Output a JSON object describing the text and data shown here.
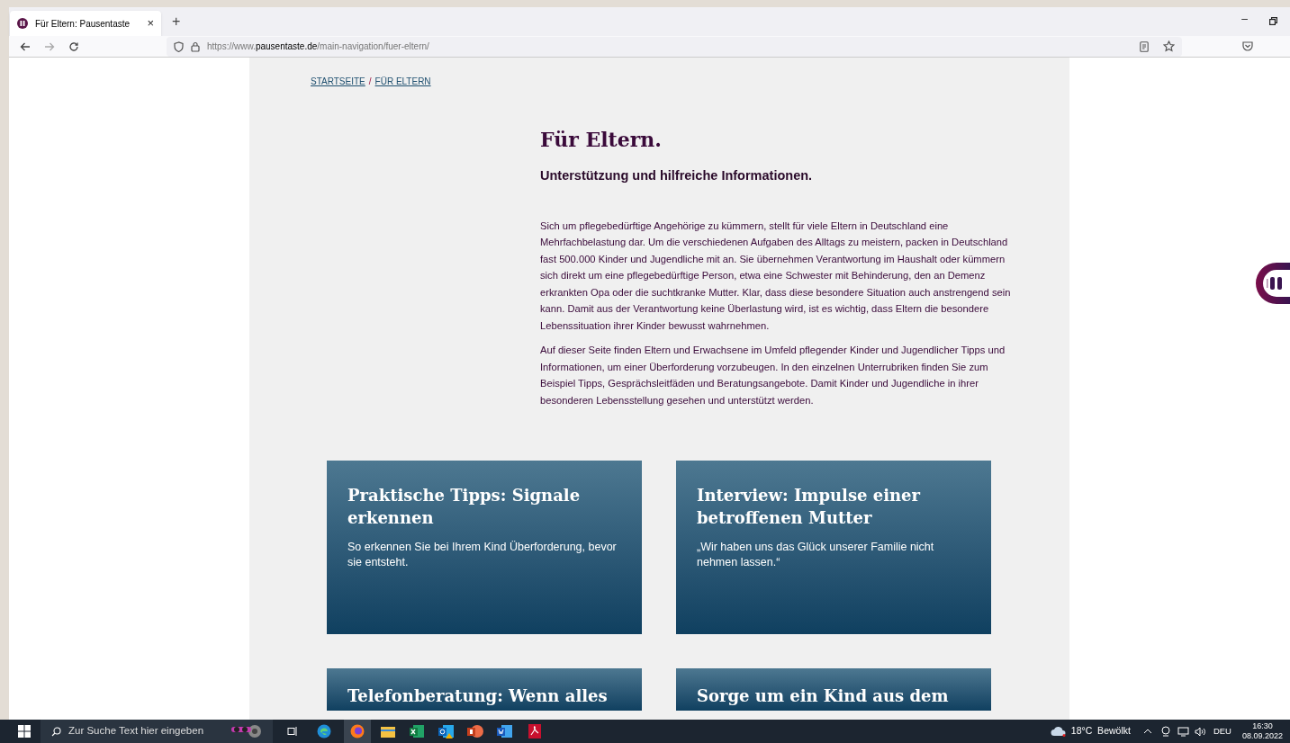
{
  "browser": {
    "tab_title": "Für Eltern: Pausentaste",
    "tab_close": "×",
    "new_tab": "+",
    "window_min": "–",
    "url_prefix": "https://www.",
    "url_domain": "pausentaste.de",
    "url_path": "/main-navigation/fuer-eltern/"
  },
  "breadcrumb": [
    {
      "label": "STARTSEITE"
    },
    {
      "label": "FÜR ELTERN"
    }
  ],
  "breadcrumb_separator": "/",
  "page": {
    "title": "Für Eltern.",
    "subtitle": "Unterstützung und hilfreiche Informationen.",
    "paragraphs": [
      "Sich um pflegebedürftige Angehörige zu kümmern, stellt für viele Eltern in Deutschland eine Mehrfachbelastung dar. Um die verschiedenen Aufgaben des Alltags zu meistern, packen in Deutschland fast 500.000 Kinder und Jugendliche mit an. Sie übernehmen Verantwortung im Haushalt oder kümmern sich direkt um eine pflegebedürftige Person, etwa eine Schwester mit Behinderung, den an Demenz erkrankten Opa oder die suchtkranke Mutter. Klar, dass diese besondere Situation auch anstrengend sein kann. Damit aus der Verantwortung keine Überlastung wird, ist es wichtig, dass Eltern die besondere Lebenssituation ihrer Kinder bewusst wahrnehmen.",
      "Auf dieser Seite finden Eltern und Erwachsene im Umfeld pflegender Kinder und Jugendlicher Tipps und Informationen, um einer Überforderung vorzubeugen. In den einzelnen Unterrubriken finden Sie zum Beispiel Tipps, Gesprächsleitfäden und Beratungsangebote. Damit Kinder und Jugendliche in ihrer besonderen Lebensstellung gesehen und unterstützt werden."
    ]
  },
  "cards": [
    {
      "title": "Praktische Tipps: Signale erkennen",
      "text": "So erkennen Sie bei Ihrem Kind Überforderung, bevor sie entsteht."
    },
    {
      "title": "Interview: Impulse einer betroffenen Mutter",
      "text": "„Wir haben uns das Glück unserer Familie nicht nehmen lassen.“"
    },
    {
      "title": "Telefonberatung: Wenn alles"
    },
    {
      "title": "Sorge um ein Kind aus dem"
    }
  ],
  "taskbar": {
    "search_placeholder": "Zur Suche Text hier eingeben",
    "weather": "18°C  Bewölkt",
    "language": "DEU",
    "time": "16:30",
    "date": "08.09.2022"
  }
}
